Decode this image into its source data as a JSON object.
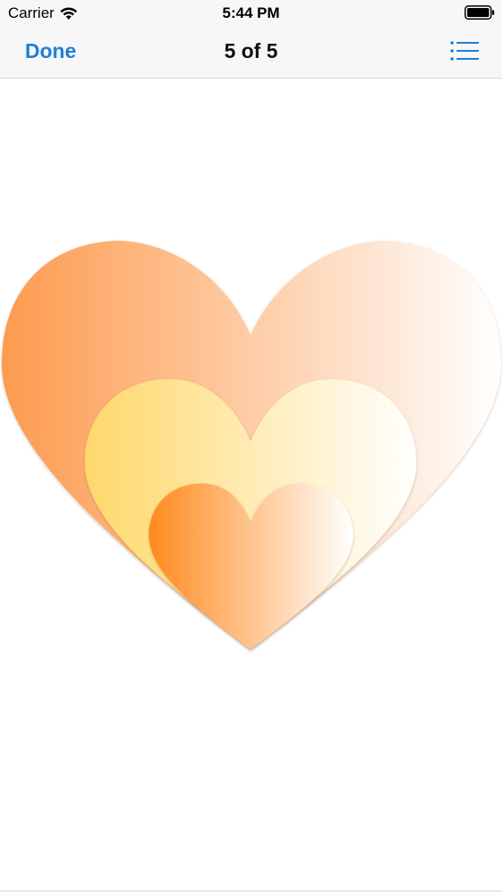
{
  "status_bar": {
    "carrier": "Carrier",
    "time": "5:44 PM",
    "icons": [
      "wifi-icon",
      "battery-icon"
    ]
  },
  "nav_bar": {
    "done_label": "Done",
    "title": "5 of 5",
    "list_icon": "list-icon"
  },
  "colors": {
    "accent": "#1e7fd8",
    "heart_large": [
      "#fd9a4e",
      "#ffffff"
    ],
    "heart_medium": [
      "#ffd86a",
      "#ffffff"
    ],
    "heart_small": [
      "#ff8a1f",
      "#ffffff"
    ]
  }
}
